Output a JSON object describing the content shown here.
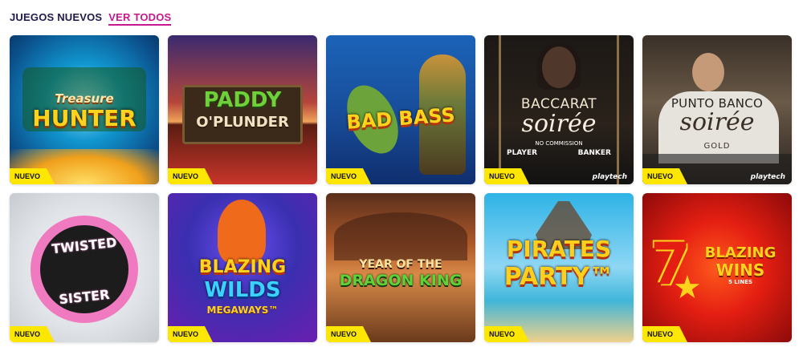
{
  "header": {
    "title": "JUEGOS NUEVOS",
    "view_all": "VER TODOS"
  },
  "badge_label": "NUEVO",
  "games": [
    {
      "title_line1": "Treasure",
      "title_line2": "HUNTER",
      "icon": "treasure-hunter-art",
      "colors": [
        "#0b6fb0",
        "#0f8fb4",
        "#f4b21b"
      ]
    },
    {
      "title_line1": "PADDY",
      "title_line2": "O'PLUNDER",
      "icon": "paddy-plunder-art",
      "colors": [
        "#2f1f58",
        "#c63b24",
        "#e9b36a"
      ]
    },
    {
      "title_line1": "BAD BASS",
      "icon": "bad-bass-art",
      "colors": [
        "#1a4fa0",
        "#0f2e6e",
        "#f6c51f"
      ]
    },
    {
      "title_line1": "BACCARAT",
      "title_line2": "soirée",
      "subtitle": "NO COMMISSION",
      "table_labels": [
        "PLAYER",
        "BANKER"
      ],
      "provider": "playtech",
      "icon": "baccarat-soiree-art",
      "colors": [
        "#151515",
        "#3a2a1c",
        "#e5cfa3"
      ]
    },
    {
      "title_line1": "PUNTO BANCO",
      "title_line2": "soirée",
      "subtitle": "GOLD",
      "provider": "playtech",
      "icon": "punto-banco-art",
      "colors": [
        "#2a2420",
        "#6b5a4a",
        "#e9e2d8"
      ]
    },
    {
      "title_line1": "TWISTED",
      "title_line2": "SISTER",
      "icon": "twisted-sister-art",
      "colors": [
        "#e7e9ec",
        "#1a1a1a",
        "#f07ac0"
      ]
    },
    {
      "title_line1": "BLAZING",
      "title_line2": "WILDS",
      "subtitle": "MEGAWAYS™",
      "icon": "blazing-wilds-art",
      "colors": [
        "#2a2fa8",
        "#7a1fb8",
        "#ffc61c"
      ]
    },
    {
      "title_line1": "YEAR OF THE",
      "title_line2": "DRAGON KING",
      "icon": "dragon-king-art",
      "colors": [
        "#7a3a20",
        "#d27a3a",
        "#2f9d49"
      ]
    },
    {
      "title_line1": "PIRATES",
      "title_line2": "PARTY™",
      "icon": "pirates-party-art",
      "colors": [
        "#2eb3e6",
        "#8fd7f4",
        "#f3b623"
      ]
    },
    {
      "title_line1": "BLAZING",
      "title_line2": "WINS",
      "subtitle": "5 LINES",
      "icon": "blazing-wins-art",
      "colors": [
        "#8c0a0a",
        "#e41e12",
        "#ffd21c"
      ]
    }
  ]
}
